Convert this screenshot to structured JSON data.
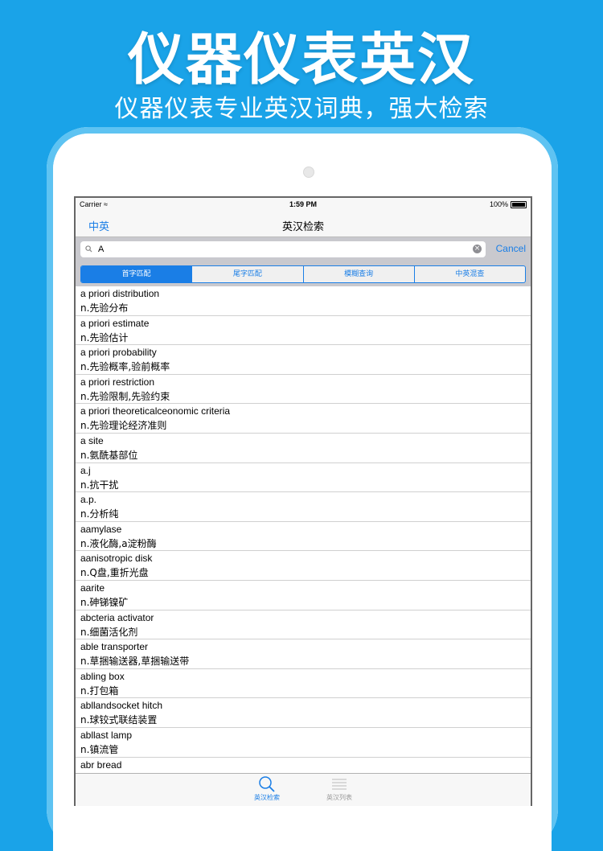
{
  "promo": {
    "title": "仪器仪表英汉",
    "subtitle": "仪器仪表专业英汉词典，强大检索"
  },
  "status_bar": {
    "carrier": "Carrier",
    "time": "1:59 PM",
    "battery": "100%"
  },
  "nav": {
    "left_button": "中英",
    "title": "英汉检索"
  },
  "search": {
    "value": "A",
    "cancel_label": "Cancel"
  },
  "segments": [
    {
      "label": "首字匹配",
      "active": true
    },
    {
      "label": "尾字匹配",
      "active": false
    },
    {
      "label": "模糊查询",
      "active": false
    },
    {
      "label": "中英混查",
      "active": false
    }
  ],
  "entries": [
    {
      "en": "a priori distribution",
      "zh": "n.先验分布"
    },
    {
      "en": "a priori estimate",
      "zh": "n.先验估计"
    },
    {
      "en": "a priori probability",
      "zh": "n.先验概率,验前概率"
    },
    {
      "en": "a priori restriction",
      "zh": "n.先验限制,先验约束"
    },
    {
      "en": "a priori theoreticalceonomic criteria",
      "zh": "n.先验理论经济准则"
    },
    {
      "en": "a site",
      "zh": "n.氨酰基部位"
    },
    {
      "en": "a.j",
      "zh": "n.抗干扰"
    },
    {
      "en": "a.p.",
      "zh": "n.分析纯"
    },
    {
      "en": "aamylase",
      "zh": "n.液化酶,a淀粉酶"
    },
    {
      "en": "aanisotropic disk",
      "zh": "n.Q盘,重折光盘"
    },
    {
      "en": "aarite",
      "zh": "n.砷锑镍矿"
    },
    {
      "en": "abcteria activator",
      "zh": "n.细菌活化剂"
    },
    {
      "en": "able transporter",
      "zh": "n.草捆输送器,草捆输送带"
    },
    {
      "en": "abling box",
      "zh": "n.打包箱"
    },
    {
      "en": "abllandsocket hitch",
      "zh": "n.球铰式联结装置"
    },
    {
      "en": "abllast lamp",
      "zh": "n.镇流管"
    },
    {
      "en": "abr bread",
      "zh": ""
    }
  ],
  "tabs": [
    {
      "label": "英汉检索",
      "icon": "magnifier-icon",
      "active": true
    },
    {
      "label": "英汉列表",
      "icon": "list-icon",
      "active": false
    }
  ],
  "colors": {
    "background": "#1aa3e8",
    "accent": "#1a7ee6"
  }
}
